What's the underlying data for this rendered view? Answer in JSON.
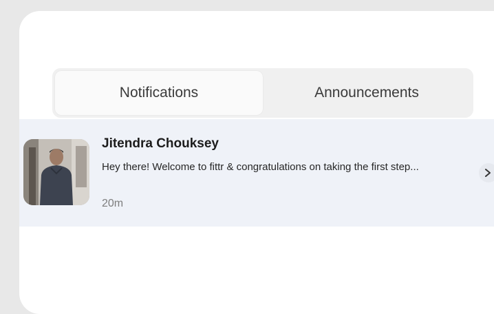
{
  "tabs": {
    "items": [
      {
        "label": "Notifications",
        "active": true
      },
      {
        "label": "Announcements",
        "active": false
      }
    ],
    "more_icon": "more-vertical-icon"
  },
  "notification": {
    "sender": "Jitendra Chouksey",
    "message": "Hey there! Welcome to fittr & congratulations on taking the first step...",
    "time": "20m",
    "avatar": "profile-photo",
    "action_icon": "chevron-right-icon"
  },
  "colors": {
    "background": "#e8e8e8",
    "card": "#ffffff",
    "tabbar": "#f0f0f0",
    "active_tab": "#fafafa",
    "notification_bg": "#eff2f8"
  }
}
